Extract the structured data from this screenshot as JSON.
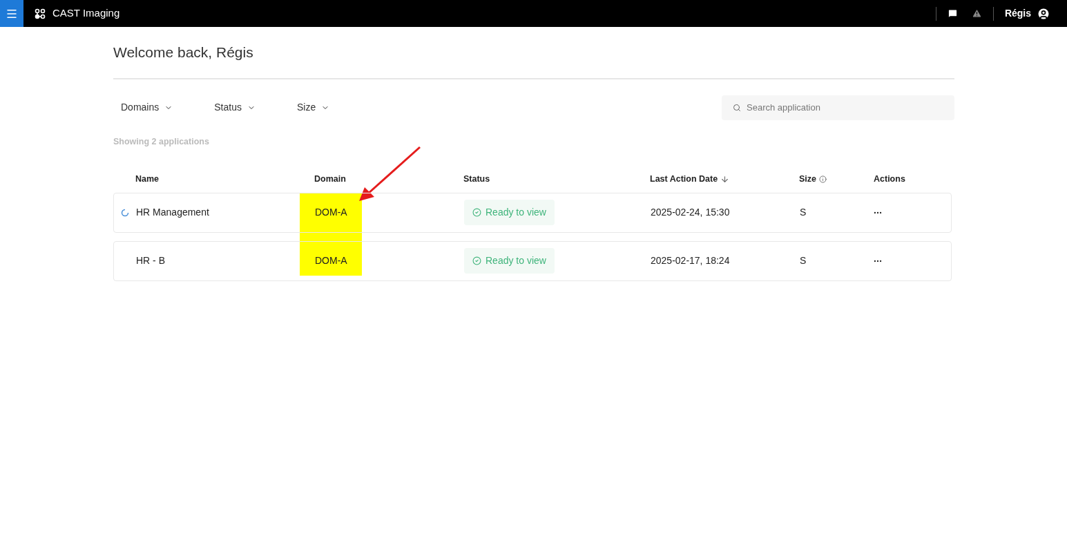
{
  "topbar": {
    "app_name": "CAST Imaging",
    "user": "Régis"
  },
  "welcome": "Welcome back, Régis",
  "filters": [
    {
      "label": "Domains"
    },
    {
      "label": "Status"
    },
    {
      "label": "Size"
    }
  ],
  "search": {
    "placeholder": "Search application"
  },
  "count": "Showing 2 applications",
  "table": {
    "columns": [
      "Name",
      "Domain",
      "Status",
      "Last Action Date",
      "Size",
      "Actions"
    ],
    "rows": [
      {
        "loading": true,
        "name": "HR Management",
        "domain": "DOM-A",
        "status": {
          "kind": "ready",
          "label": "Ready to view"
        },
        "date": "2025-02-24, 15:30",
        "size": "S"
      },
      {
        "loading": false,
        "name": "HR - B",
        "domain": "DOM-A",
        "status": {
          "kind": "ready",
          "label": "Ready to view"
        },
        "date": "2025-02-17, 18:24",
        "size": "S"
      }
    ]
  }
}
